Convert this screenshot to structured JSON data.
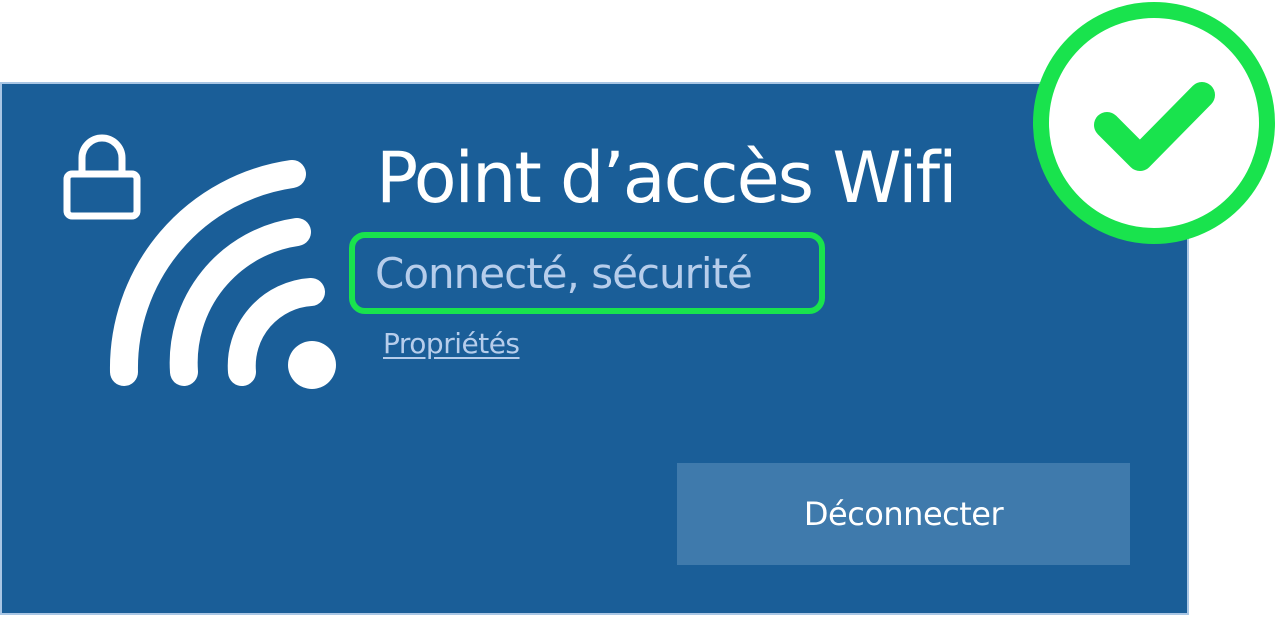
{
  "network": {
    "name": "Point d’accès Wifi",
    "status": "Connecté, sécurité",
    "properties_link": "Propriétés",
    "disconnect_label": "Déconnecter"
  },
  "icons": {
    "lock": "lock-icon",
    "wifi": "wifi-signal-icon",
    "check": "check-circle-icon"
  },
  "colors": {
    "panel_background": "#1a5e98",
    "button_background": "#3f7aac",
    "highlight_green": "#19e34d",
    "status_text": "#b6cdeb",
    "title_text": "#ffffff"
  }
}
